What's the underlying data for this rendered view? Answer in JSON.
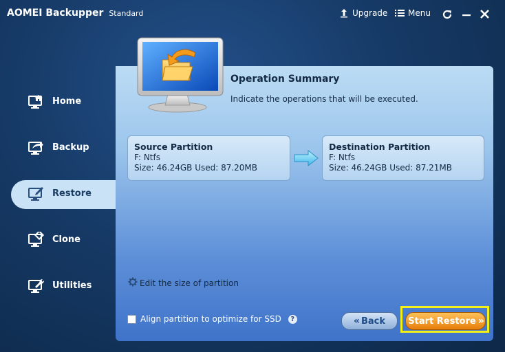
{
  "app": {
    "title": "AOMEI Backupper",
    "edition": "Standard"
  },
  "titlebar": {
    "upgrade_label": "Upgrade",
    "menu_label": "Menu"
  },
  "sidebar": {
    "items": [
      {
        "label": "Home",
        "icon": "home-icon"
      },
      {
        "label": "Backup",
        "icon": "backup-icon"
      },
      {
        "label": "Restore",
        "icon": "restore-icon",
        "active": true
      },
      {
        "label": "Clone",
        "icon": "clone-icon"
      },
      {
        "label": "Utilities",
        "icon": "utilities-icon"
      }
    ]
  },
  "summary": {
    "title": "Operation Summary",
    "description": "Indicate the operations that will be executed."
  },
  "source": {
    "title": "Source Partition",
    "filesystem": "F: Ntfs",
    "size": "Size: 46.24GB  Used: 87.20MB"
  },
  "destination": {
    "title": "Destination Partition",
    "filesystem": "F: Ntfs",
    "size": "Size: 46.24GB  Used: 87.21MB"
  },
  "options": {
    "edit_size_label": "Edit the size of partition",
    "align_label": "Align partition to optimize for SSD",
    "align_checked": false
  },
  "buttons": {
    "back_label": "Back",
    "start_label": "Start Restore"
  },
  "colors": {
    "accent_orange": "#e77e0b",
    "highlight": "#f4f01a",
    "active_tab": "#c9e2f6"
  }
}
